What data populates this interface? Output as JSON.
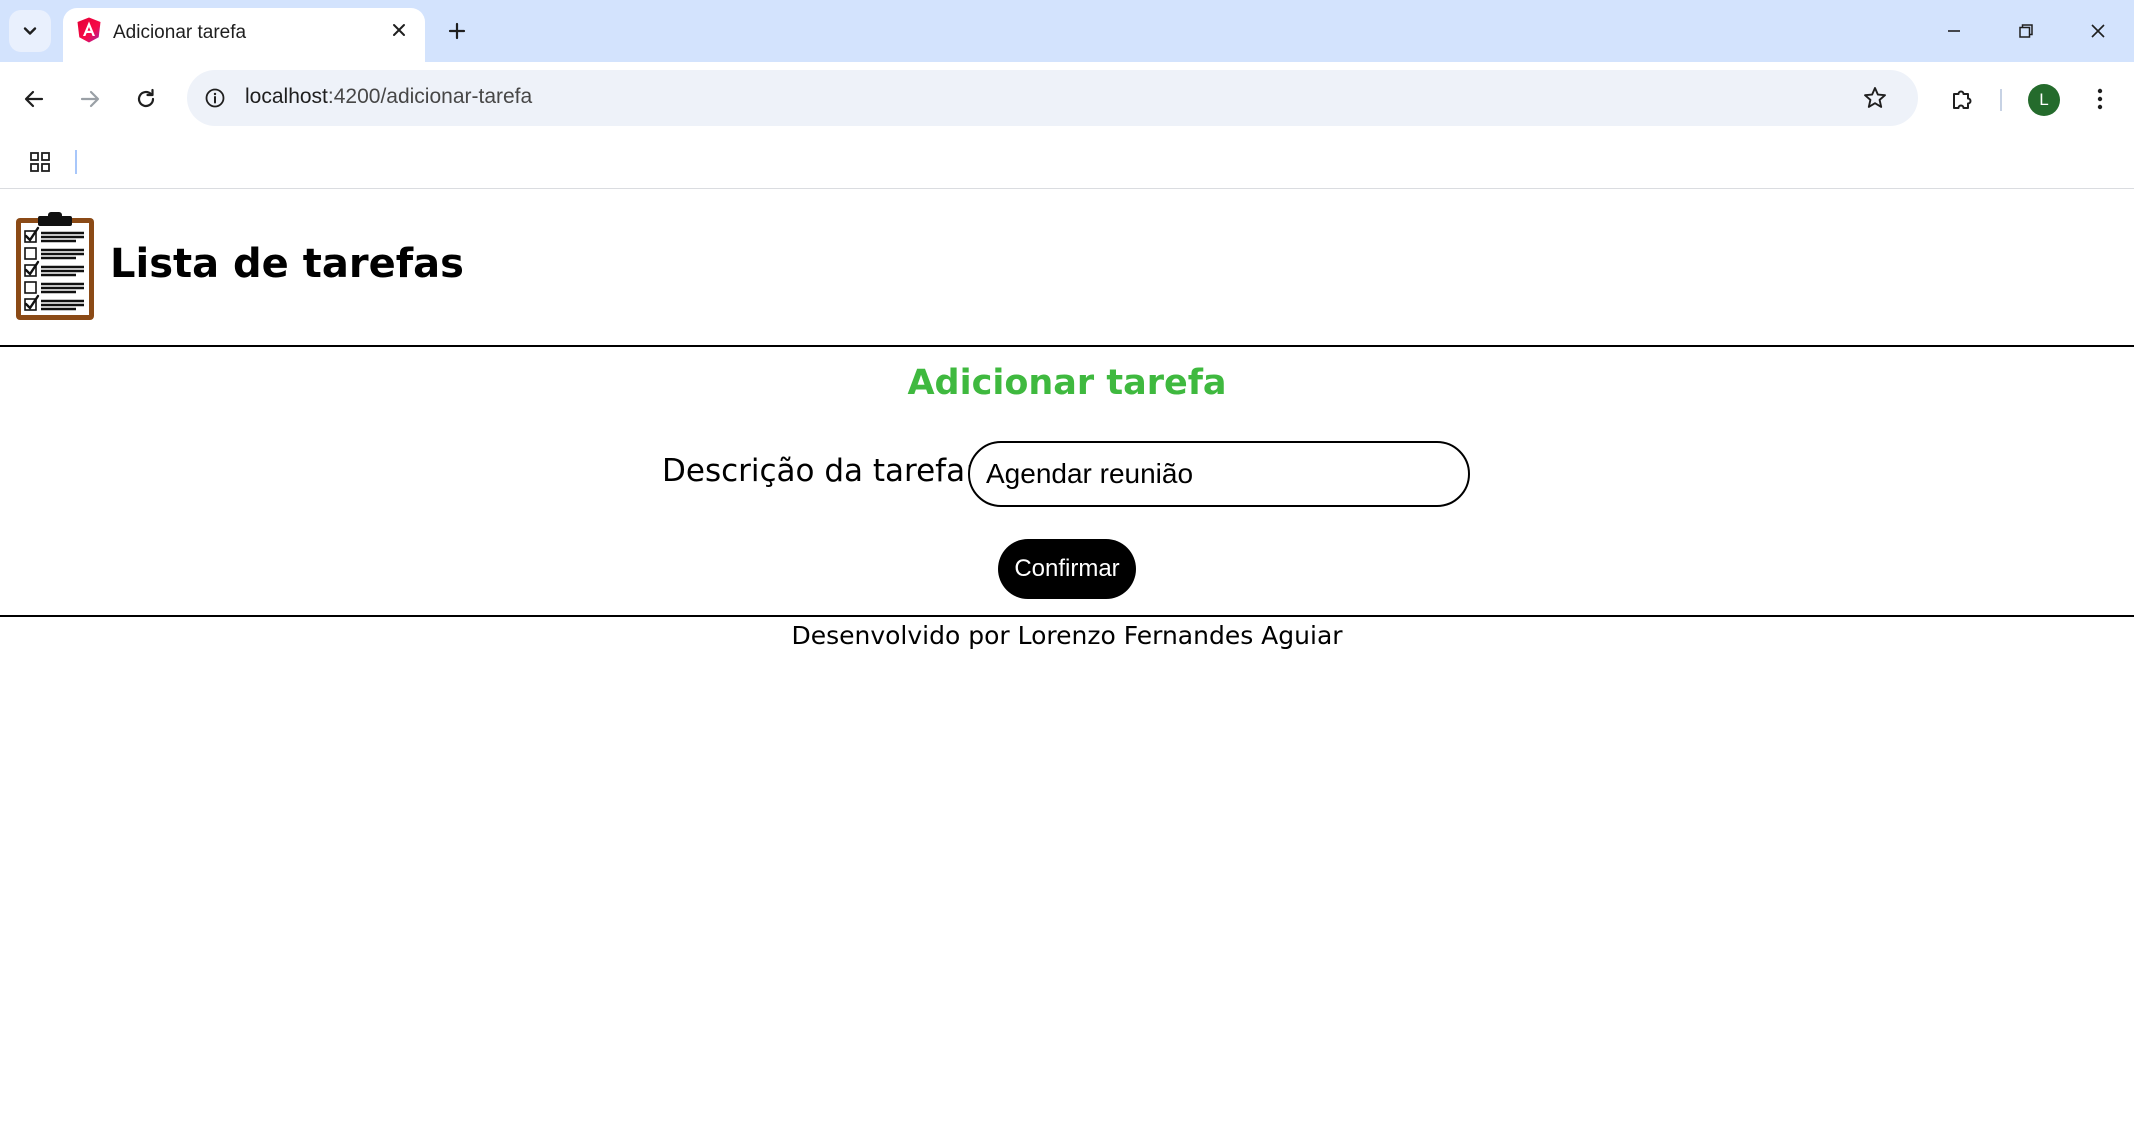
{
  "browser": {
    "tab": {
      "title": "Adicionar tarefa",
      "favicon": "angular-logo-icon"
    },
    "address": {
      "host": "localhost",
      "path": ":4200/adicionar-tarefa"
    },
    "profile_initial": "L",
    "colors": {
      "tabstrip": "#d3e3fd",
      "avatar": "#246b2c",
      "omnibox": "#eef2f9"
    }
  },
  "header": {
    "title": "Lista de tarefas",
    "logo": "clipboard-checklist-icon"
  },
  "form": {
    "title": "Adicionar tarefa",
    "description_label": "Descrição da tarefa:",
    "description_value": "Agendar reunião",
    "confirm_label": "Confirmar",
    "colors": {
      "title": "#3fb93f",
      "button": "#000000"
    }
  },
  "footer": {
    "text": "Desenvolvido por Lorenzo Fernandes Aguiar"
  }
}
